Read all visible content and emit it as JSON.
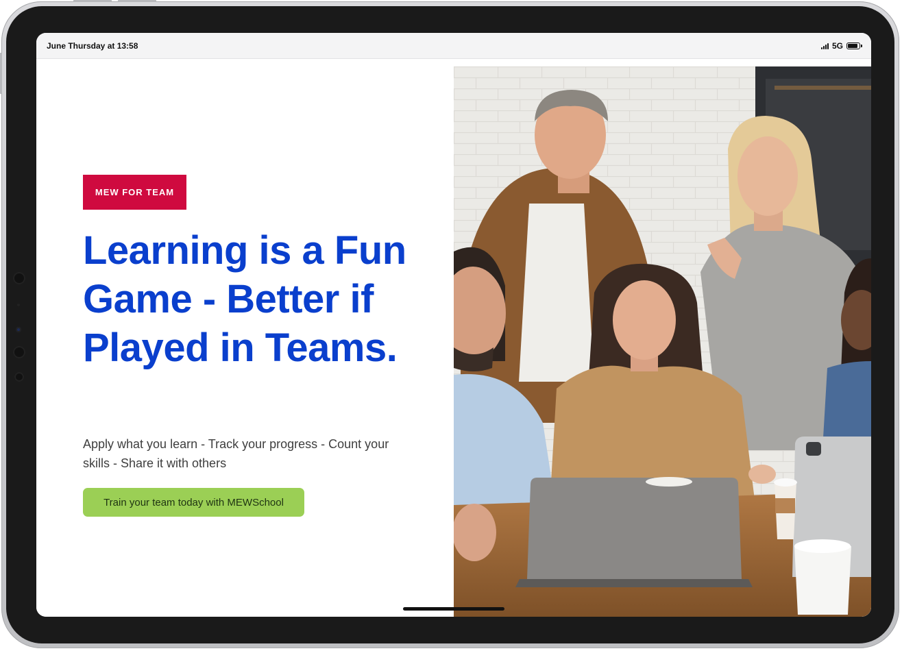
{
  "status_bar": {
    "time": "June Thursday at 13:58",
    "network": "5G",
    "signal_icon": "signal-bars-icon",
    "battery_icon": "battery-icon",
    "battery_level": 0.9
  },
  "hero": {
    "tag": "MEW FOR TEAM",
    "headline": "Learning is a Fun Game - Better if Played in Teams.",
    "subtext": "Apply what you learn - Track your progress - Count your skills - Share it with others",
    "cta_label": "Train your team today with MEWSchool"
  },
  "colors": {
    "tag_bg": "#cf0a3f",
    "headline": "#0a3fcd",
    "cta_bg": "#9bcf55"
  }
}
